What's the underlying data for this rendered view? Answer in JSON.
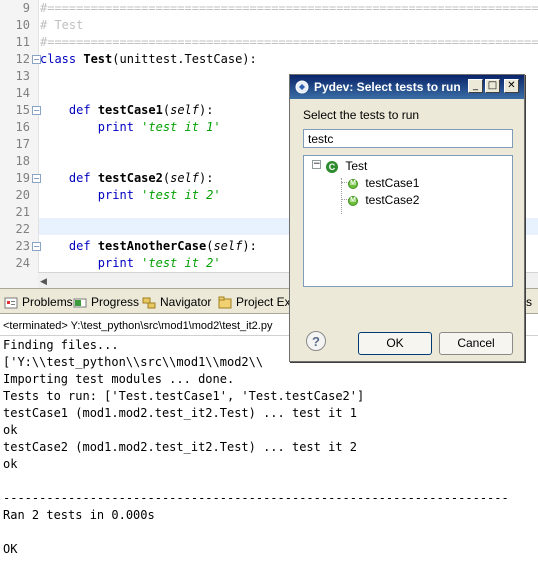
{
  "editor": {
    "lines": [
      {
        "num": "9",
        "text": "#=========================================================================="
      },
      {
        "num": "10",
        "text": "# Test"
      },
      {
        "num": "11",
        "text": "#=========================================================================="
      },
      {
        "num": "12",
        "kw": "class",
        "name": "Test",
        "rest": "(unittest.TestCase):"
      },
      {
        "num": "13"
      },
      {
        "num": "14"
      },
      {
        "num": "15",
        "kw": "def",
        "name": "testCase1",
        "param": "self",
        "rest": "):"
      },
      {
        "num": "16",
        "kw": "print",
        "str": "'test it 1'"
      },
      {
        "num": "17"
      },
      {
        "num": "18"
      },
      {
        "num": "19",
        "kw": "def",
        "name": "testCase2",
        "param": "self",
        "rest": "):"
      },
      {
        "num": "20",
        "kw": "print",
        "str": "'test it 2'"
      },
      {
        "num": "21"
      },
      {
        "num": "22"
      },
      {
        "num": "23",
        "kw": "def",
        "name": "testAnotherCase",
        "param": "self",
        "rest": "):"
      },
      {
        "num": "24",
        "kw": "print",
        "str": "'test it 2'"
      }
    ]
  },
  "views": {
    "tabs": [
      {
        "label": "Problems",
        "icon": "problems-icon"
      },
      {
        "label": "Progress",
        "icon": "progress-icon"
      },
      {
        "label": "Navigator",
        "icon": "navigator-icon"
      },
      {
        "label": "Project Exp",
        "icon": "project-explorer-icon"
      },
      {
        "label": "s",
        "icon": ""
      }
    ]
  },
  "console": {
    "title": "<terminated> Y:\\test_python\\src\\mod1\\mod2\\test_it2.py",
    "lines": [
      "Finding files...",
      "['Y:\\\\test_python\\\\src\\\\mod1\\\\mod2\\\\",
      "Importing test modules ... done.",
      "Tests to run: ['Test.testCase1', 'Test.testCase2']",
      "testCase1 (mod1.mod2.test_it2.Test) ... test it 1",
      "ok",
      "testCase2 (mod1.mod2.test_it2.Test) ... test it 2",
      "ok",
      "",
      "----------------------------------------------------------------------",
      "Ran 2 tests in 0.000s",
      "",
      "OK"
    ]
  },
  "dialog": {
    "title": "Pydev: Select tests to run",
    "prompt": "Select the tests to run",
    "filter_value": "testc",
    "tree": {
      "class_name": "Test",
      "class_icon_letter": "C",
      "methods": [
        "testCase1",
        "testCase2"
      ]
    },
    "help_label": "?",
    "ok_label": "OK",
    "cancel_label": "Cancel",
    "title_buttons": {
      "minimize": "_",
      "maximize": "□",
      "close": "✕"
    }
  }
}
